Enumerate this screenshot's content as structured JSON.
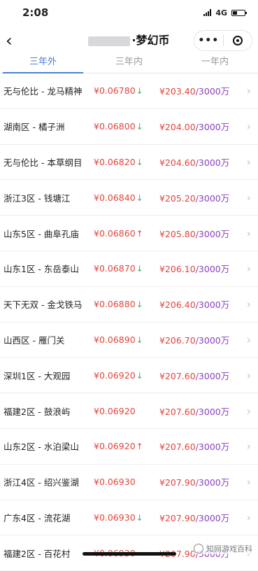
{
  "status": {
    "time": "2:08",
    "network": "4G"
  },
  "nav": {
    "title": "·梦幻币",
    "more": "•••"
  },
  "tabs": [
    {
      "label": "三年外",
      "active": true
    },
    {
      "label": "三年内",
      "active": false
    },
    {
      "label": "一年内",
      "active": false
    }
  ],
  "rows": [
    {
      "name": "无与伦比 - 龙马精神",
      "price": "¥0.06780",
      "trend": "down",
      "total": "¥203.40",
      "unit": "/3000万"
    },
    {
      "name": "湖南区 - 橘子洲",
      "price": "¥0.06800",
      "trend": "down",
      "total": "¥204.00",
      "unit": "/3000万"
    },
    {
      "name": "无与伦比 - 本草纲目",
      "price": "¥0.06820",
      "trend": "down",
      "total": "¥204.60",
      "unit": "/3000万"
    },
    {
      "name": "浙江3区 - 钱塘江",
      "price": "¥0.06840",
      "trend": "down",
      "total": "¥205.20",
      "unit": "/3000万"
    },
    {
      "name": "山东5区 - 曲阜孔庙",
      "price": "¥0.06860",
      "trend": "up",
      "total": "¥205.80",
      "unit": "/3000万"
    },
    {
      "name": "山东1区 - 东岳泰山",
      "price": "¥0.06870",
      "trend": "down",
      "total": "¥206.10",
      "unit": "/3000万"
    },
    {
      "name": "天下无双 - 金戈铁马",
      "price": "¥0.06880",
      "trend": "down",
      "total": "¥206.40",
      "unit": "/3000万"
    },
    {
      "name": "山西区 - 雁门关",
      "price": "¥0.06890",
      "trend": "down",
      "total": "¥206.70",
      "unit": "/3000万"
    },
    {
      "name": "深圳1区 - 大观园",
      "price": "¥0.06920",
      "trend": "down",
      "total": "¥207.60",
      "unit": "/3000万"
    },
    {
      "name": "福建2区 - 鼓浪屿",
      "price": "¥0.06920",
      "trend": "",
      "total": "¥207.60",
      "unit": "/3000万"
    },
    {
      "name": "山东2区 - 水泊梁山",
      "price": "¥0.06920",
      "trend": "up",
      "total": "¥207.60",
      "unit": "/3000万"
    },
    {
      "name": "浙江4区 - 绍兴鉴湖",
      "price": "¥0.06930",
      "trend": "",
      "total": "¥207.90",
      "unit": "/3000万"
    },
    {
      "name": "广东4区 - 流花湖",
      "price": "¥0.06930",
      "trend": "down",
      "total": "¥207.90",
      "unit": "/3000万"
    },
    {
      "name": "福建2区 - 百花村",
      "price": "¥0.06930",
      "trend": "",
      "total": "¥207.90",
      "unit": "/3000万"
    }
  ],
  "watermark": "知网游戏百科",
  "colors": {
    "accent": "#4a7fd6",
    "price": "#e2453c",
    "down": "#3db36b",
    "unit": "#8a3fbf"
  }
}
